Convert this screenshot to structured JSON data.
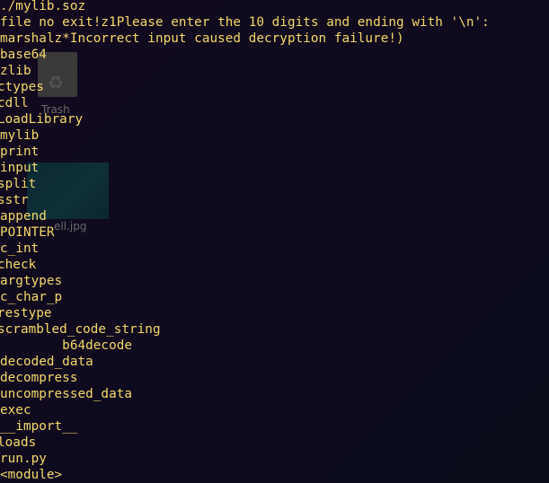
{
  "desktop": {
    "trash_icon": "trash-icon",
    "trash_label": "Trash",
    "image_label": "ell.jpg",
    "colors": {
      "background": "#0f0a1e",
      "terminal_text": "#f4d86a",
      "icon_label": "#6a6a6a"
    }
  },
  "terminal": {
    "lines": [
      "./mylib.soz",
      "file no exit!z1Please enter the 10 digits and ending with '\\n':",
      "marshalz*Incorrect input caused decryption failure!)",
      "base64",
      "zlib",
      "ctypes",
      "cdll",
      "LoadLibrary",
      "mylib",
      "print",
      "input",
      "split",
      "sstr",
      "append",
      "POINTER",
      "c_int",
      "check",
      "argtypes",
      "c_char_p",
      "restype",
      "scrambled_code_string",
      "        b64decode",
      "decoded_data",
      "decompress",
      "uncompressed_data",
      "exec",
      "__import__",
      "loads",
      "run.py",
      "<module>"
    ]
  }
}
